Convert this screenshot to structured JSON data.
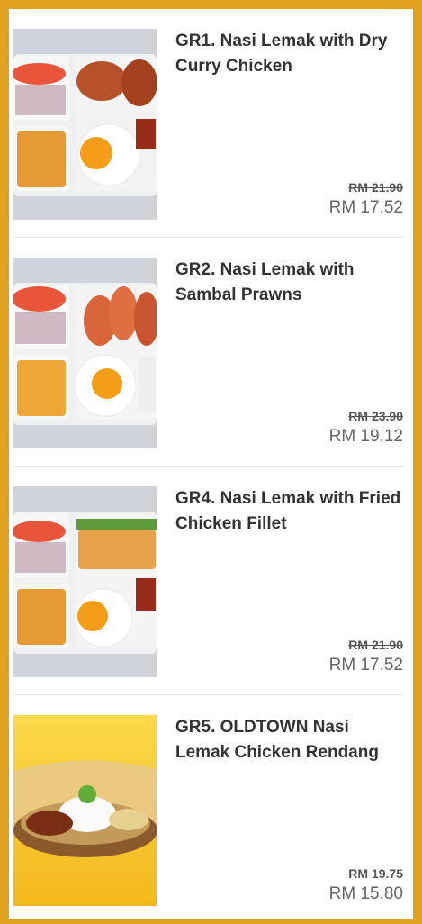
{
  "items": [
    {
      "title": "GR1.  Nasi Lemak with Dry Curry Chicken",
      "old_price": "RM 21.90",
      "price": "RM 17.52",
      "image": "bento-box-image"
    },
    {
      "title": "GR2.  Nasi Lemak with Sambal Prawns",
      "old_price": "RM 23.90",
      "price": "RM 19.12",
      "image": "bento-box-image"
    },
    {
      "title": "GR4.  Nasi Lemak with Fried Chicken Fillet",
      "old_price": "RM 21.90",
      "price": "RM 17.52",
      "image": "bento-box-image"
    },
    {
      "title": "GR5. OLDTOWN Nasi Lemak Chicken Rendang",
      "old_price": "RM 19.75",
      "price": "RM 15.80",
      "image": "basket-plate-image"
    }
  ],
  "colors": {
    "frame": "#e0a020",
    "price": "#666666",
    "title": "#333333"
  }
}
